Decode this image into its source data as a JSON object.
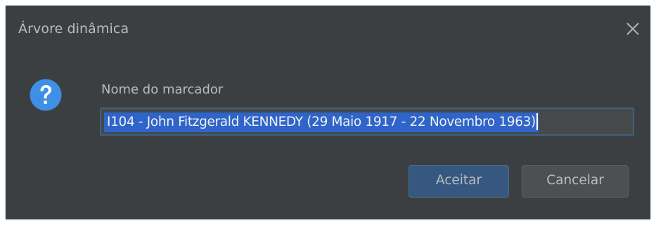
{
  "dialog": {
    "title": "Árvore dinâmica",
    "close_icon": "close-icon",
    "question_icon": "question-mark-icon",
    "prompt_label": "Nome do marcador",
    "input_value": "I104 - John Fitzgerald KENNEDY (29 Maio 1917 - 22 Novembro 1963)",
    "ok_label": "Aceitar",
    "cancel_label": "Cancelar"
  },
  "colors": {
    "background": "#3c3f41",
    "text": "#bbbbbb",
    "selection": "#2f65ca",
    "primary_button": "#365880",
    "icon_blue": "#3f8fe6"
  }
}
